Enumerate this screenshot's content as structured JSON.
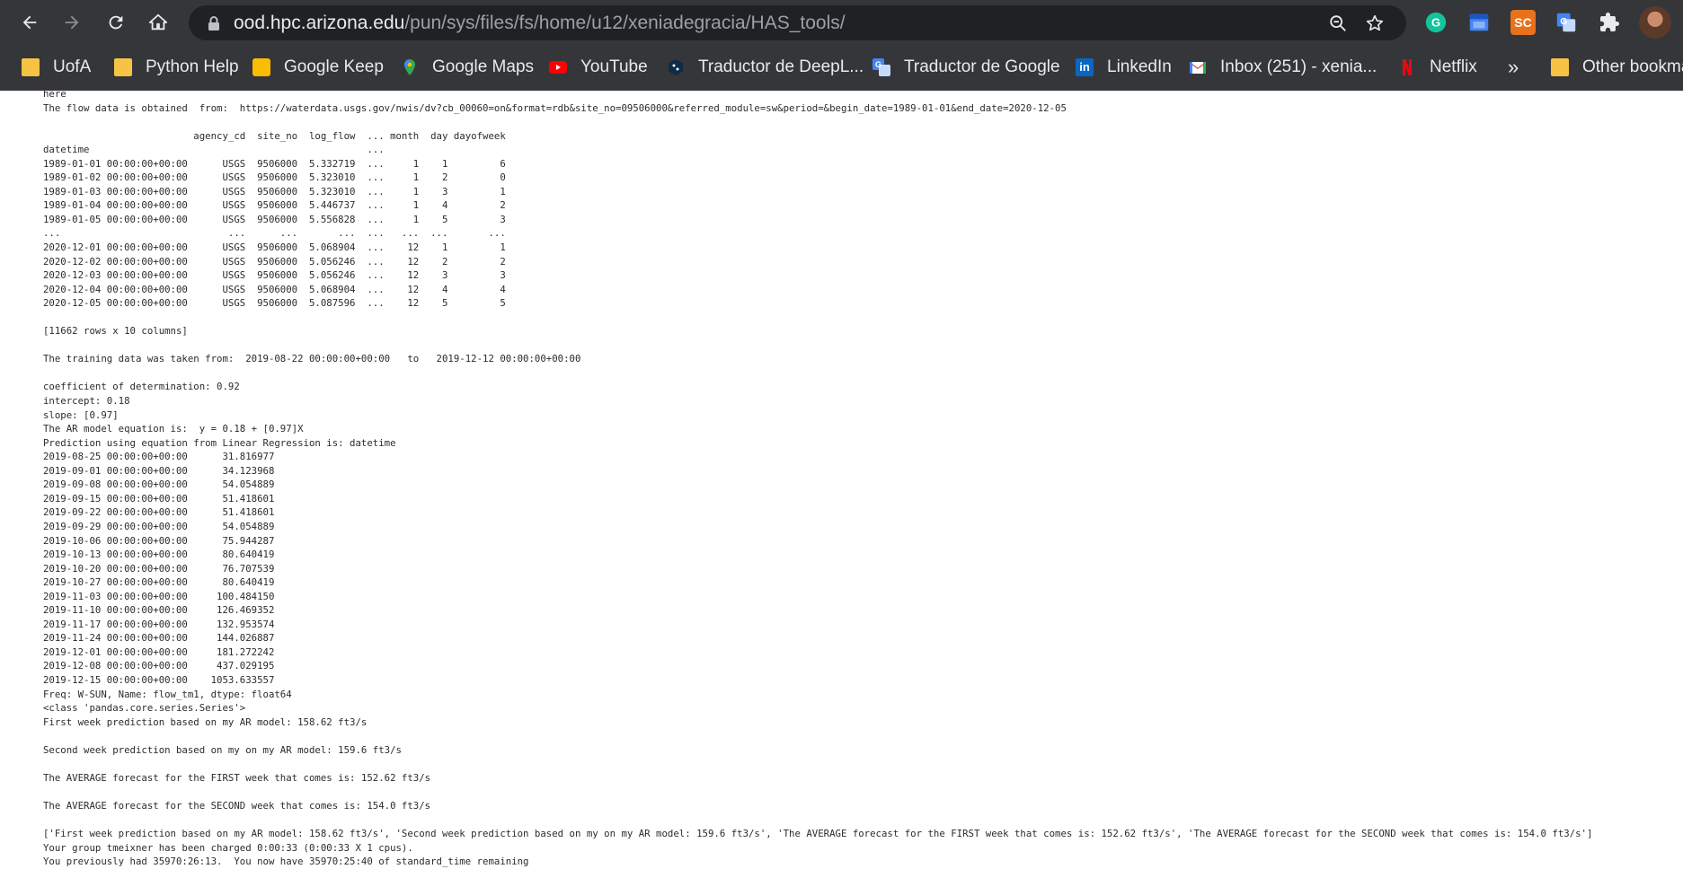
{
  "browser": {
    "url_host": "ood.hpc.arizona.edu",
    "url_path": "/pun/sys/files/fs/home/u12/xeniadegracia/HAS_tools/",
    "extensions": [
      "grammarly-icon",
      "calendar-icon",
      "sc-icon",
      "translate-icon",
      "puzzle-icon"
    ],
    "ext_sc_label": "SC"
  },
  "bookmarks": {
    "items": [
      {
        "label": "UofA",
        "icon": "folder-icon"
      },
      {
        "label": "Python Help",
        "icon": "folder-icon"
      },
      {
        "label": "Google Keep",
        "icon": "google-keep-icon"
      },
      {
        "label": "Google Maps",
        "icon": "google-maps-icon"
      },
      {
        "label": "YouTube",
        "icon": "youtube-icon"
      },
      {
        "label": "Traductor de DeepL...",
        "icon": "deepl-icon"
      },
      {
        "label": "Traductor de Google",
        "icon": "google-translate-icon"
      },
      {
        "label": "LinkedIn",
        "icon": "linkedin-icon"
      },
      {
        "label": "Inbox (251) - xenia...",
        "icon": "gmail-icon"
      },
      {
        "label": "Netflix",
        "icon": "netflix-icon"
      }
    ],
    "overflow_label": "»",
    "other_label": "Other bookmarks"
  },
  "colors": {
    "chrome_bg": "#35363a",
    "omnibox_bg": "#202124",
    "text_light": "#e8eaed",
    "folder": "#f6c344",
    "youtube": "#ff0000",
    "netflix": "#e50914",
    "linkedin": "#0a66c2"
  },
  "output": {
    "lines": [
      "here",
      "The flow data is obtained  from:  https://waterdata.usgs.gov/nwis/dv?cb_00060=on&format=rdb&site_no=09506000&referred_module=sw&period=&begin_date=1989-01-01&end_date=2020-12-05",
      "",
      "                          agency_cd  site_no  log_flow  ... month  day dayofweek",
      "datetime                                                ...",
      "1989-01-01 00:00:00+00:00      USGS  9506000  5.332719  ...     1    1         6",
      "1989-01-02 00:00:00+00:00      USGS  9506000  5.323010  ...     1    2         0",
      "1989-01-03 00:00:00+00:00      USGS  9506000  5.323010  ...     1    3         1",
      "1989-01-04 00:00:00+00:00      USGS  9506000  5.446737  ...     1    4         2",
      "1989-01-05 00:00:00+00:00      USGS  9506000  5.556828  ...     1    5         3",
      "...                             ...      ...       ...  ...   ...  ...       ...",
      "2020-12-01 00:00:00+00:00      USGS  9506000  5.068904  ...    12    1         1",
      "2020-12-02 00:00:00+00:00      USGS  9506000  5.056246  ...    12    2         2",
      "2020-12-03 00:00:00+00:00      USGS  9506000  5.056246  ...    12    3         3",
      "2020-12-04 00:00:00+00:00      USGS  9506000  5.068904  ...    12    4         4",
      "2020-12-05 00:00:00+00:00      USGS  9506000  5.087596  ...    12    5         5",
      "",
      "[11662 rows x 10 columns]",
      "",
      "The training data was taken from:  2019-08-22 00:00:00+00:00   to   2019-12-12 00:00:00+00:00",
      "",
      "coefficient of determination: 0.92",
      "intercept: 0.18",
      "slope: [0.97]",
      "The AR model equation is:  y = 0.18 + [0.97]X",
      "Prediction using equation from Linear Regression is: datetime",
      "2019-08-25 00:00:00+00:00      31.816977",
      "2019-09-01 00:00:00+00:00      34.123968",
      "2019-09-08 00:00:00+00:00      54.054889",
      "2019-09-15 00:00:00+00:00      51.418601",
      "2019-09-22 00:00:00+00:00      51.418601",
      "2019-09-29 00:00:00+00:00      54.054889",
      "2019-10-06 00:00:00+00:00      75.944287",
      "2019-10-13 00:00:00+00:00      80.640419",
      "2019-10-20 00:00:00+00:00      76.707539",
      "2019-10-27 00:00:00+00:00      80.640419",
      "2019-11-03 00:00:00+00:00     100.484150",
      "2019-11-10 00:00:00+00:00     126.469352",
      "2019-11-17 00:00:00+00:00     132.953574",
      "2019-11-24 00:00:00+00:00     144.026887",
      "2019-12-01 00:00:00+00:00     181.272242",
      "2019-12-08 00:00:00+00:00     437.029195",
      "2019-12-15 00:00:00+00:00    1053.633557",
      "Freq: W-SUN, Name: flow_tm1, dtype: float64",
      "<class 'pandas.core.series.Series'>",
      "First week prediction based on my AR model: 158.62 ft3/s",
      "",
      "Second week prediction based on my on my AR model: 159.6 ft3/s",
      "",
      "The AVERAGE forecast for the FIRST week that comes is: 152.62 ft3/s",
      "",
      "The AVERAGE forecast for the SECOND week that comes is: 154.0 ft3/s",
      "",
      "['First week prediction based on my AR model: 158.62 ft3/s', 'Second week prediction based on my on my AR model: 159.6 ft3/s', 'The AVERAGE forecast for the FIRST week that comes is: 152.62 ft3/s', 'The AVERAGE forecast for the SECOND week that comes is: 154.0 ft3/s']",
      "Your group tmeixner has been charged 0:00:33 (0:00:33 X 1 cpus).",
      "You previously had 35970:26:13.  You now have 35970:25:40 of standard_time remaining"
    ]
  }
}
